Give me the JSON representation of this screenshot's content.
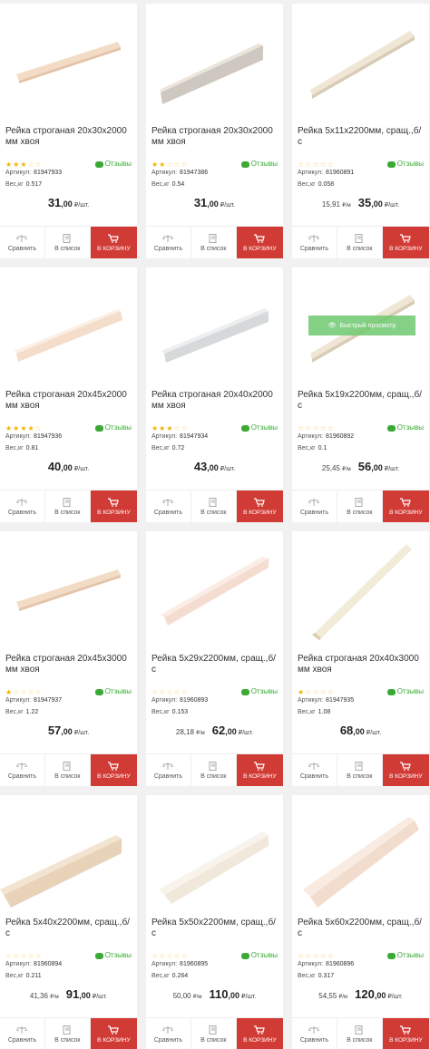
{
  "labels": {
    "reviews": "Отзывы",
    "article": "Артикул:",
    "weight": "Вес,кг",
    "compare": "Сравнить",
    "to_list": "В список",
    "to_cart": "В КОРЗИНУ",
    "per_piece": "₽/шт.",
    "per_meter": "₽/м",
    "quick_view": "Быстрый просмотр"
  },
  "products": [
    {
      "title": "Рейка строганая 20х30х2000 мм хвоя",
      "article": "81947933",
      "weight": "0.517",
      "rating": 3,
      "price_int": "31",
      "price_cents": ",00",
      "per_meter": "",
      "image": "slat-thin-diagonal"
    },
    {
      "title": "Рейка строганая 20х30х2000 мм хвоя",
      "article": "81947386",
      "weight": "0.54",
      "rating": 2,
      "price_int": "31",
      "price_cents": ",00",
      "per_meter": "",
      "image": "slat-grey-thick"
    },
    {
      "title": "Рейка 5x11x2200мм, сращ.,б/с",
      "article": "81960891",
      "weight": "0.058",
      "rating": 0,
      "price_int": "35",
      "price_cents": ",00",
      "per_meter": "15,91",
      "image": "slat-light"
    },
    {
      "title": "Рейка строганая 20х45х2000 мм хвоя",
      "article": "81947936",
      "weight": "0.81",
      "rating": 4,
      "price_int": "40",
      "price_cents": ",00",
      "per_meter": "",
      "image": "slat-pink"
    },
    {
      "title": "Рейка строганая 20х40х2000 мм хвоя",
      "article": "81947934",
      "weight": "0.72",
      "rating": 3,
      "price_int": "43",
      "price_cents": ",00",
      "per_meter": "",
      "image": "slat-grey"
    },
    {
      "title": "Рейка 5x19x2200мм, сращ.,б/с",
      "article": "81960892",
      "weight": "0.1",
      "rating": 0,
      "price_int": "56",
      "price_cents": ",00",
      "per_meter": "25,45",
      "image": "slat-light",
      "quick_view": true
    },
    {
      "title": "Рейка строганая 20х45х3000 мм хвоя",
      "article": "81947937",
      "weight": "1.22",
      "rating": 1,
      "price_int": "57",
      "price_cents": ",00",
      "per_meter": "",
      "image": "slat-thin-diagonal"
    },
    {
      "title": "Рейка 5x29x2200мм, сращ.,б/с",
      "article": "81960893",
      "weight": "0.153",
      "rating": 0,
      "price_int": "62",
      "price_cents": ",00",
      "per_meter": "28,18",
      "image": "slat-pink-wide"
    },
    {
      "title": "Рейка строганая 20х40х3000 мм хвоя",
      "article": "81947935",
      "weight": "1.08",
      "rating": 1,
      "price_int": "68",
      "price_cents": ",00",
      "per_meter": "",
      "image": "slat-steep"
    },
    {
      "title": "Рейка 5x40x2200мм, сращ.,б/с",
      "article": "81960894",
      "weight": "0.211",
      "rating": 0,
      "price_int": "91",
      "price_cents": ",00",
      "per_meter": "41,36",
      "image": "board-tan"
    },
    {
      "title": "Рейка 5x50x2200мм, сращ.,б/с",
      "article": "81960895",
      "weight": "0.264",
      "rating": 0,
      "price_int": "110",
      "price_cents": ",00",
      "per_meter": "50,00",
      "image": "board-light"
    },
    {
      "title": "Рейка 5x60x2200мм, сращ.,б/с",
      "article": "81960896",
      "weight": "0.317",
      "rating": 0,
      "price_int": "120",
      "price_cents": ",00",
      "per_meter": "54,55",
      "image": "board-wide"
    }
  ],
  "colors": {
    "cart": "#d13b36",
    "reviews": "#3aaa35",
    "star": "#f0b400"
  }
}
